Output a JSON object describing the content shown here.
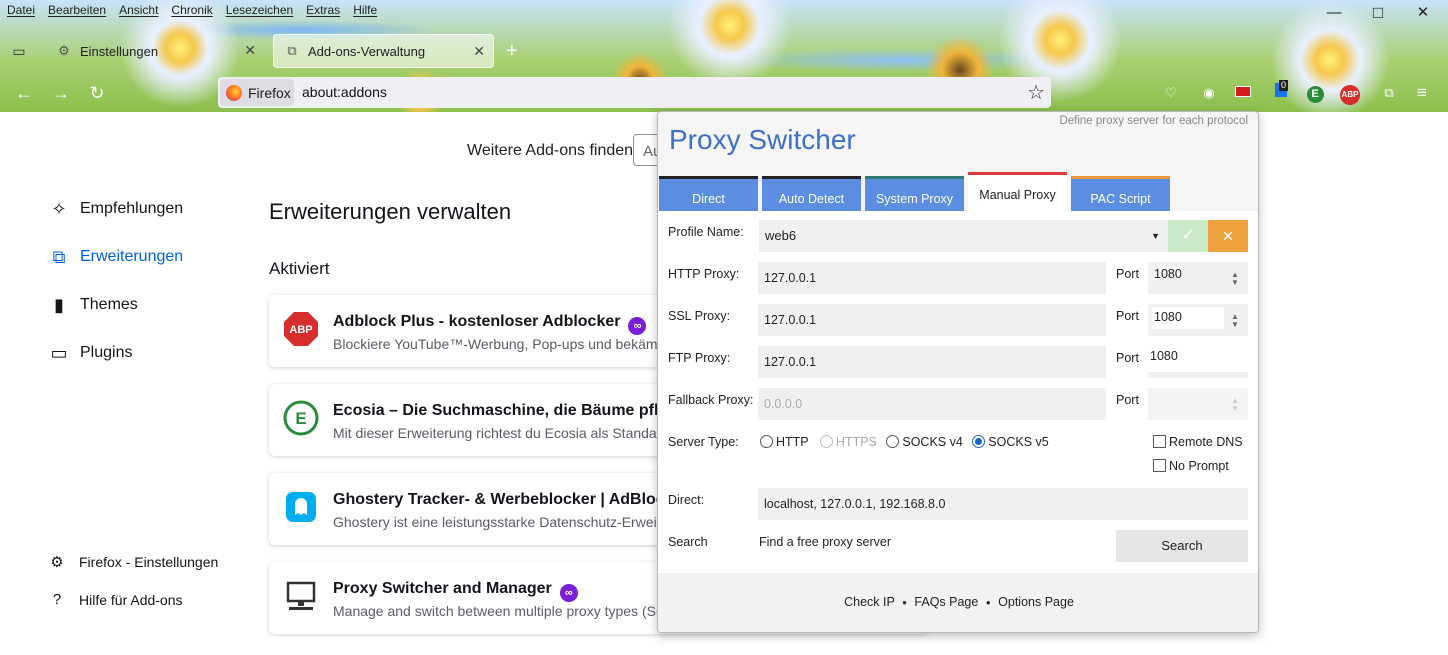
{
  "menu": [
    "Datei",
    "Bearbeiten",
    "Ansicht",
    "Chronik",
    "Lesezeichen",
    "Extras",
    "Hilfe"
  ],
  "window_controls": {
    "minimize": "—",
    "maximize": "□",
    "close": "✕"
  },
  "tabs": [
    {
      "label": "Einstellungen",
      "icon": "gear-icon"
    },
    {
      "label": "Add-ons-Verwaltung",
      "icon": "puzzle-icon"
    }
  ],
  "new_tab": "+",
  "urlbar": {
    "identity": "Firefox",
    "url": "about:addons"
  },
  "toolbar_badges": {
    "badge1": "0",
    "badge2": "E",
    "badge3": "ABP"
  },
  "find": {
    "label": "Weitere Add-ons finden",
    "placeholder": "Au"
  },
  "categories": [
    {
      "label": "Empfehlungen",
      "icon": "sparkle-icon"
    },
    {
      "label": "Erweiterungen",
      "icon": "puzzle-icon"
    },
    {
      "label": "Themes",
      "icon": "brush-icon"
    },
    {
      "label": "Plugins",
      "icon": "plugin-icon"
    }
  ],
  "footer_links": [
    {
      "label": "Firefox - Einstellungen",
      "icon": "gear-icon"
    },
    {
      "label": "Hilfe für Add-ons",
      "icon": "help-icon"
    }
  ],
  "main": {
    "heading": "Erweiterungen verwalten",
    "section": "Aktiviert",
    "extensions": [
      {
        "name": "Adblock Plus - kostenloser Adblocker",
        "desc": "Blockiere YouTube™-Werbung, Pop-ups und bekämpfe",
        "icon": "abp-icon",
        "recommended": true
      },
      {
        "name": "Ecosia – Die Suchmaschine, die Bäume pflanzt",
        "desc": "Mit dieser Erweiterung richtest du Ecosia als Standardsu",
        "icon": "ecosia-icon",
        "recommended": false
      },
      {
        "name": "Ghostery Tracker- & Werbeblocker | AdBlocker",
        "desc": "Ghostery ist eine leistungsstarke Datenschutz-Erweiterung",
        "icon": "ghostery-icon",
        "recommended": false
      },
      {
        "name": "Proxy Switcher and Manager",
        "desc": "Manage and switch between multiple proxy types (SOCKS",
        "icon": "monitor-icon",
        "recommended": true
      }
    ]
  },
  "popup": {
    "title": "Proxy Switcher",
    "subtitle": "Define proxy server for each protocol",
    "tabs": [
      "Direct",
      "Auto Detect",
      "System Proxy",
      "Manual Proxy",
      "PAC Script"
    ],
    "tab_colors": [
      "#5b8ee0",
      "#5b8ee0",
      "#5b8ee0",
      "#ffffff",
      "#5b8ee0"
    ],
    "tab_accents": [
      "#222222",
      "#222222",
      "#2f7b6b",
      "#e03a3a",
      "#e8973a"
    ],
    "profile": {
      "label": "Profile Name:",
      "value": "web6",
      "save": "✓",
      "cancel": "✕"
    },
    "http": {
      "label": "HTTP Proxy:",
      "value": "127.0.0.1",
      "port_label": "Port",
      "port": "1080"
    },
    "ssl": {
      "label": "SSL Proxy:",
      "value": "127.0.0.1",
      "port_label": "Port",
      "port": "1080"
    },
    "ftp": {
      "label": "FTP Proxy:",
      "value": "127.0.0.1",
      "port_label": "Port",
      "port": "1080"
    },
    "fallback": {
      "label": "Fallback Proxy:",
      "placeholder": "0.0.0.0",
      "port_label": "Port"
    },
    "server_type": {
      "label": "Server Type:",
      "options": [
        "HTTP",
        "HTTPS",
        "SOCKS v4",
        "SOCKS v5"
      ],
      "selected": "SOCKS v5"
    },
    "remote_dns": "Remote DNS",
    "no_prompt": "No Prompt",
    "direct": {
      "label": "Direct:",
      "value": "localhost, 127.0.0.1, 192.168.8.0"
    },
    "search": {
      "label": "Search",
      "text": "Find a free proxy server",
      "button": "Search"
    },
    "footer": {
      "check_ip": "Check IP",
      "faqs": "FAQs Page",
      "options": "Options Page",
      "sep": "●"
    }
  }
}
